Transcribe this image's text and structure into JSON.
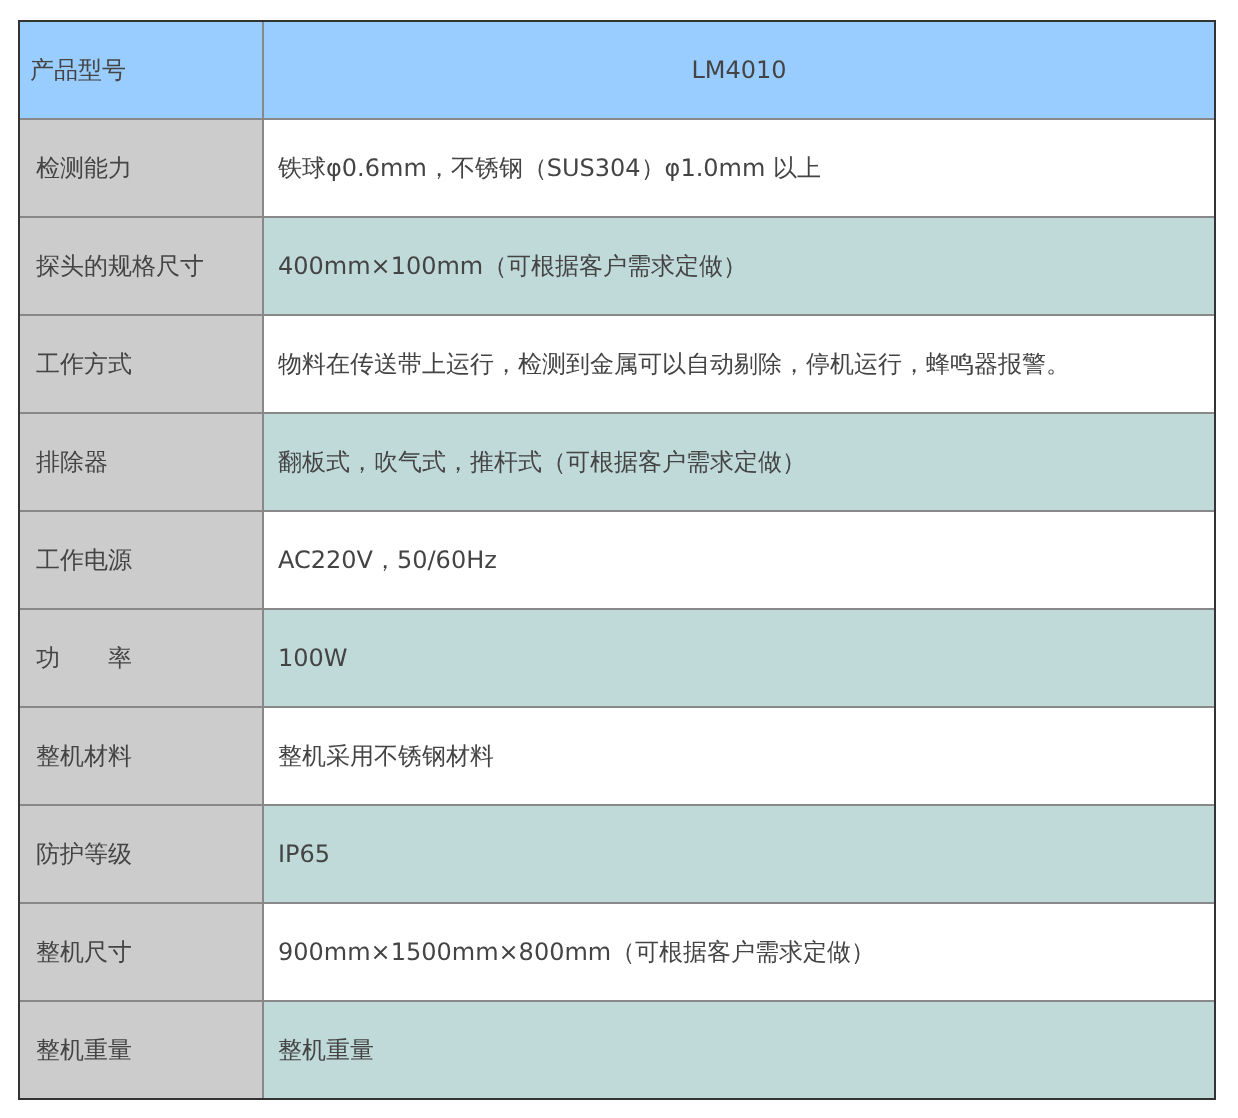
{
  "header": {
    "label": "产品型号",
    "value": "LM4010"
  },
  "rows": [
    {
      "label": "检测能力",
      "value": "铁球φ0.6mm，不锈钢（SUS304）φ1.0mm 以上"
    },
    {
      "label": "探头的规格尺寸",
      "value": "400mm×100mm（可根据客户需求定做）"
    },
    {
      "label": "工作方式",
      "value": "物料在传送带上运行，检测到金属可以自动剔除，停机运行，蜂鸣器报警。"
    },
    {
      "label": "排除器",
      "value": "翻板式，吹气式，推杆式（可根据客户需求定做）"
    },
    {
      "label": "工作电源",
      "value": "AC220V，50/60Hz"
    },
    {
      "label": "功　　率",
      "value": "100W"
    },
    {
      "label": "整机材料",
      "value": "整机采用不锈钢材料"
    },
    {
      "label": "防护等级",
      "value": "IP65"
    },
    {
      "label": "整机尺寸",
      "value": "900mm×1500mm×800mm（可根据客户需求定做）"
    },
    {
      "label": "整机重量",
      "value": "整机重量"
    }
  ]
}
